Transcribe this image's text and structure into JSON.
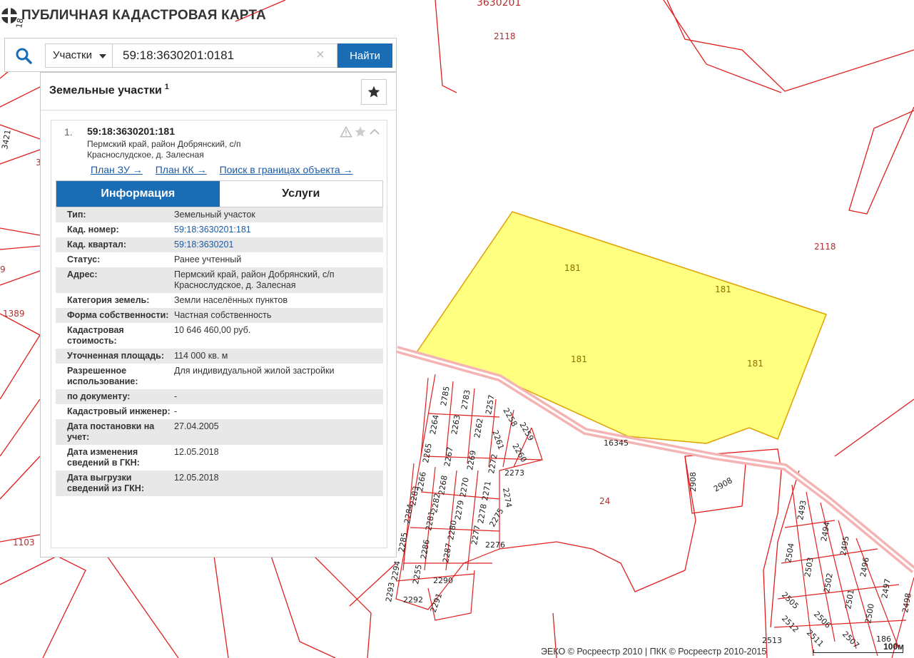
{
  "brand": {
    "title": "ПУБЛИЧНАЯ КАДАСТРОВАЯ КАРТА",
    "logo_icon": "cadastral-logo-icon"
  },
  "search": {
    "filter_value": "Участки",
    "query_value": "59:18:3630201:0181",
    "clear_icon": "×",
    "find_label": "Найти"
  },
  "results": {
    "heading": "Земельные участки",
    "count": "1",
    "item": {
      "number": "1.",
      "cadastral_number": "59:18:3630201:181",
      "address": "Пермский край, район Добрянский, с/п Краснослудское, д. Залесная",
      "links": [
        "План ЗУ →",
        "План КК →",
        "Поиск в границах объекта →"
      ]
    },
    "tabs": {
      "info": "Информация",
      "services": "Услуги"
    },
    "rows": [
      {
        "key": "Тип:",
        "value": "Земельный участок"
      },
      {
        "key": "Кад. номер:",
        "value": "59:18:3630201:181"
      },
      {
        "key": "Кад. квартал:",
        "value": "59:18:3630201"
      },
      {
        "key": "Статус:",
        "value": "Ранее учтенный"
      },
      {
        "key": "Адрес:",
        "value": "Пермский край, район Добрянский, с/п Краснослудское, д. Залесная"
      },
      {
        "key": "Категория земель:",
        "value": "Земли населённых пунктов"
      },
      {
        "key": "Форма собственности:",
        "value": "Частная собственность"
      },
      {
        "key": "Кадастровая стоимость:",
        "value": "10 646 460,00 руб."
      },
      {
        "key": "Уточненная площадь:",
        "value": "114 000 кв. м"
      },
      {
        "key": "Разрешенное использование:",
        "value": "Для индивидуальной жилой застройки"
      },
      {
        "key": "по документу:",
        "value": "-"
      },
      {
        "key": "Кадастровый инженер:",
        "value": "-"
      },
      {
        "key": "Дата постановки на учет:",
        "value": "27.04.2005"
      },
      {
        "key": "Дата изменения сведений в ГКН:",
        "value": "12.05.2018"
      },
      {
        "key": "Дата выгрузки сведений из ГКН:",
        "value": "12.05.2018"
      }
    ]
  },
  "map": {
    "parcel_color": "#ffff80",
    "boundary_color": "#e02020",
    "labels": {
      "quarter_top": "3630201",
      "l2118a": "2118",
      "l2118b": "2118",
      "p181a": "181",
      "p181b": "181",
      "p181c": "181",
      "p181d": "181",
      "l16345": "16345",
      "l24": "24",
      "l1389": "1389",
      "l1103": "1103",
      "l2908a": "2908",
      "l2908b": "2908",
      "l2785": "2785",
      "l2783": "2783",
      "l2257": "2257",
      "l2258": "2258",
      "l2259": "2259",
      "l2264": "2264",
      "l2263": "2263",
      "l2262": "2262",
      "l2261": "2261",
      "l2260": "2260",
      "l2265": "2265",
      "l2267": "2267",
      "l2269": "2269",
      "l2272": "2272",
      "l2273": "2273",
      "l2266": "2266",
      "l2268": "2268",
      "l2270": "2270",
      "l2271": "2271",
      "l2274": "2274",
      "l2283": "2283",
      "l2282": "2282",
      "l2279": "2279",
      "l2278": "2278",
      "l2275": "2275",
      "l2284": "2284",
      "l2281": "2281",
      "l2280": "2280",
      "l2277": "2277",
      "l2276": "2276",
      "l2285": "2285",
      "l2286": "2286",
      "l2287": "2287",
      "l2294": "2294",
      "l2255": "2255",
      "l2290": "2290",
      "l2293": "2293",
      "l2292": "2292",
      "l2291": "2291",
      "l2493": "2493",
      "l2494": "2494",
      "l2495": "2495",
      "l2496": "2496",
      "l2497": "2497",
      "l2498": "2498",
      "l2504": "2504",
      "l2503": "2503",
      "l2502": "2502",
      "l2501": "2501",
      "l2500": "2500",
      "l2505": "2505",
      "l2506": "2506",
      "l2507": "2507",
      "l2512": "2512",
      "l2511": "2511",
      "l2513": "2513",
      "l186": "186",
      "l9": "9",
      "l3": "3",
      "l3421": "3421",
      "l18": "18"
    }
  },
  "footer": {
    "attribution": "ЭЕКО © Росреестр 2010 | ПКК © Росреестр 2010-2015",
    "scale_label": "100м"
  }
}
